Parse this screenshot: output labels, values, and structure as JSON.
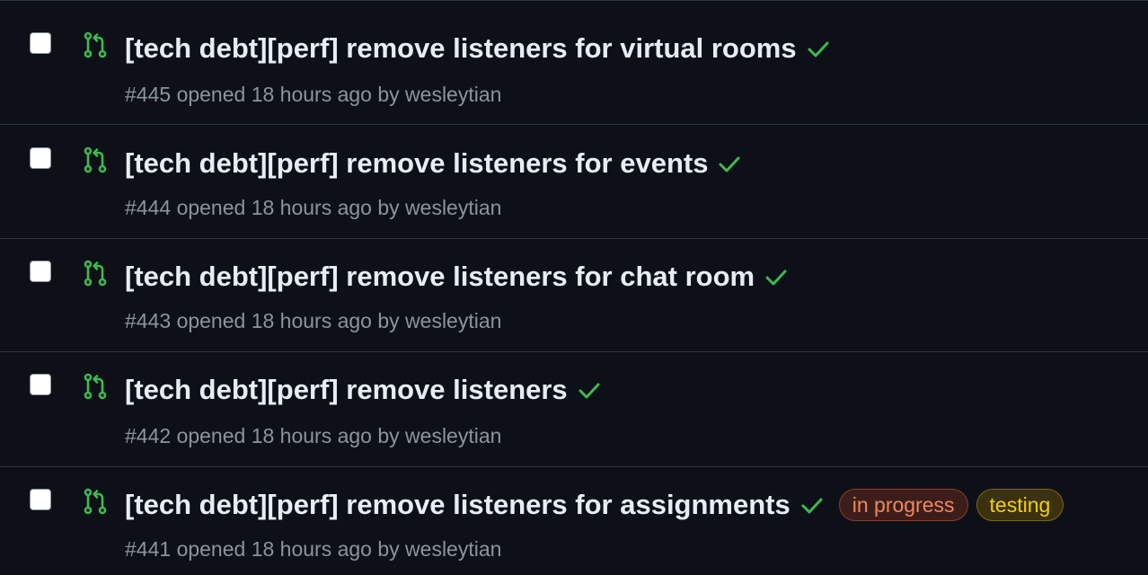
{
  "pull_requests": [
    {
      "title": "[tech debt][perf] remove listeners for virtual rooms",
      "number": "#445",
      "opened_text": "opened 18 hours ago by",
      "author": "wesleytian",
      "status": "success",
      "labels": []
    },
    {
      "title": "[tech debt][perf] remove listeners for events",
      "number": "#444",
      "opened_text": "opened 18 hours ago by",
      "author": "wesleytian",
      "status": "success",
      "labels": []
    },
    {
      "title": "[tech debt][perf] remove listeners for chat room",
      "number": "#443",
      "opened_text": "opened 18 hours ago by",
      "author": "wesleytian",
      "status": "success",
      "labels": []
    },
    {
      "title": "[tech debt][perf] remove listeners",
      "number": "#442",
      "opened_text": "opened 18 hours ago by",
      "author": "wesleytian",
      "status": "success",
      "labels": []
    },
    {
      "title": "[tech debt][perf] remove listeners for assignments",
      "number": "#441",
      "opened_text": "opened 18 hours ago by",
      "author": "wesleytian",
      "status": "success",
      "labels": [
        "in progress",
        "testing"
      ]
    }
  ],
  "colors": {
    "background": "#0d1117",
    "pr_open_icon": "#3fb950",
    "check_success": "#3fb950",
    "label_in_progress_text": "#f0885c",
    "label_testing_text": "#f5d000"
  },
  "icons": {
    "pr": "git-pull-request-icon",
    "check": "check-icon"
  }
}
